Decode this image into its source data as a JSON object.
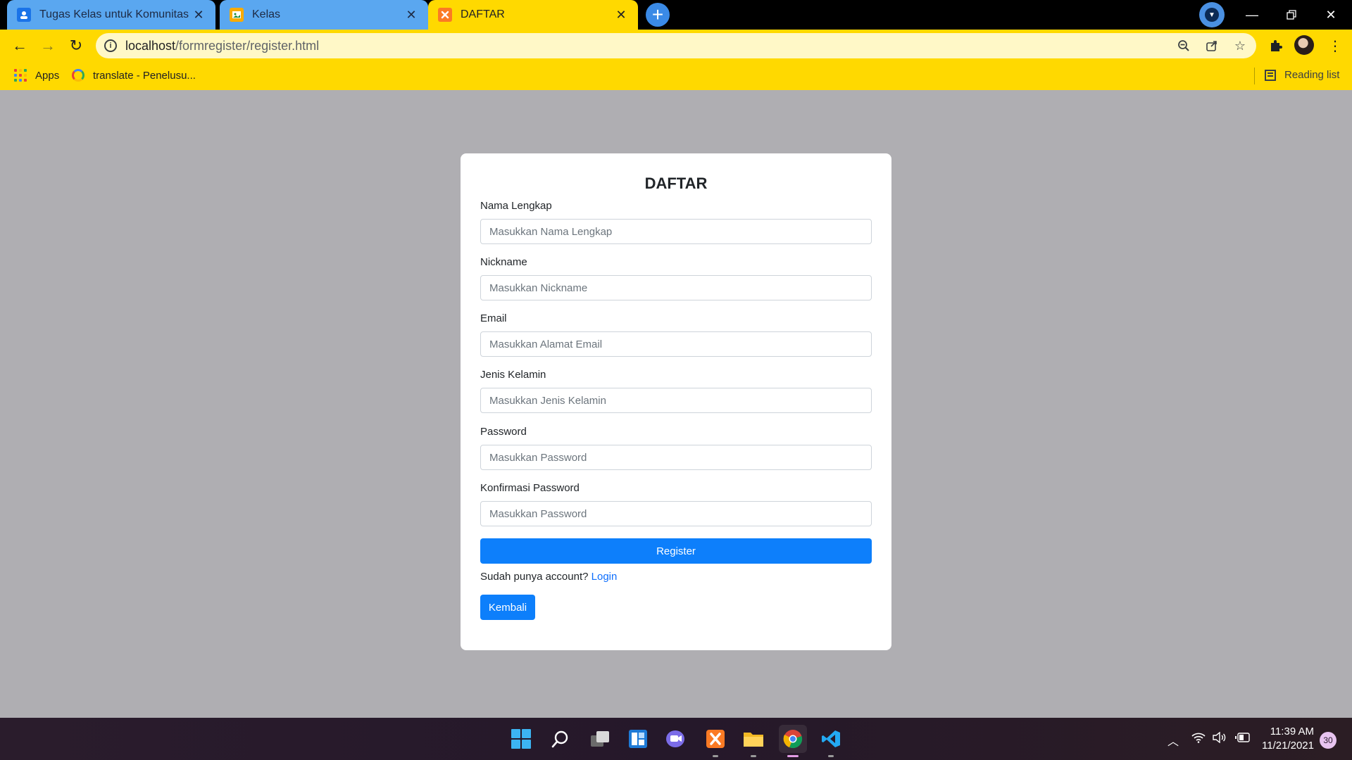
{
  "browser": {
    "tabs": [
      {
        "title": "Tugas Kelas untuk Komunitas Pro",
        "favicon": "classroom-icon",
        "active": false
      },
      {
        "title": "Kelas",
        "favicon": "classroom-image-icon",
        "active": false
      },
      {
        "title": "DAFTAR",
        "favicon": "xampp-icon",
        "active": true
      }
    ],
    "new_tab_symbol": "+",
    "url_host": "localhost",
    "url_path": "/formregister/register.html",
    "bookmarks": [
      {
        "label": "Apps",
        "icon": "apps-grid-icon"
      },
      {
        "label": "translate - Penelusu...",
        "icon": "google-icon"
      }
    ],
    "reading_list_label": "Reading list",
    "colors": {
      "accent": "#ffd900",
      "inactive_tab": "#5aa7f0"
    }
  },
  "form": {
    "title": "DAFTAR",
    "fields": [
      {
        "label": "Nama Lengkap",
        "placeholder": "Masukkan Nama Lengkap",
        "value": ""
      },
      {
        "label": "Nickname",
        "placeholder": "Masukkan Nickname",
        "value": ""
      },
      {
        "label": "Email",
        "placeholder": "Masukkan Alamat Email",
        "value": ""
      },
      {
        "label": "Jenis Kelamin",
        "placeholder": "Masukkan Jenis Kelamin",
        "value": ""
      },
      {
        "label": "Password",
        "placeholder": "Masukkan Password",
        "value": ""
      },
      {
        "label": "Konfirmasi Password",
        "placeholder": "Masukkan Password",
        "value": ""
      }
    ],
    "register_label": "Register",
    "login_prompt": "Sudah punya account?",
    "login_link": "Login",
    "back_label": "Kembali",
    "colors": {
      "primary_button": "#0d7ffb",
      "page_background": "#afaeb2"
    }
  },
  "taskbar": {
    "apps": [
      "windows-start-icon",
      "search-icon",
      "task-view-icon",
      "widgets-icon",
      "teams-chat-icon",
      "xampp-icon",
      "file-explorer-icon",
      "chrome-icon",
      "vscode-icon"
    ],
    "time": "11:39 AM",
    "date": "11/21/2021",
    "notification_count": "30"
  }
}
